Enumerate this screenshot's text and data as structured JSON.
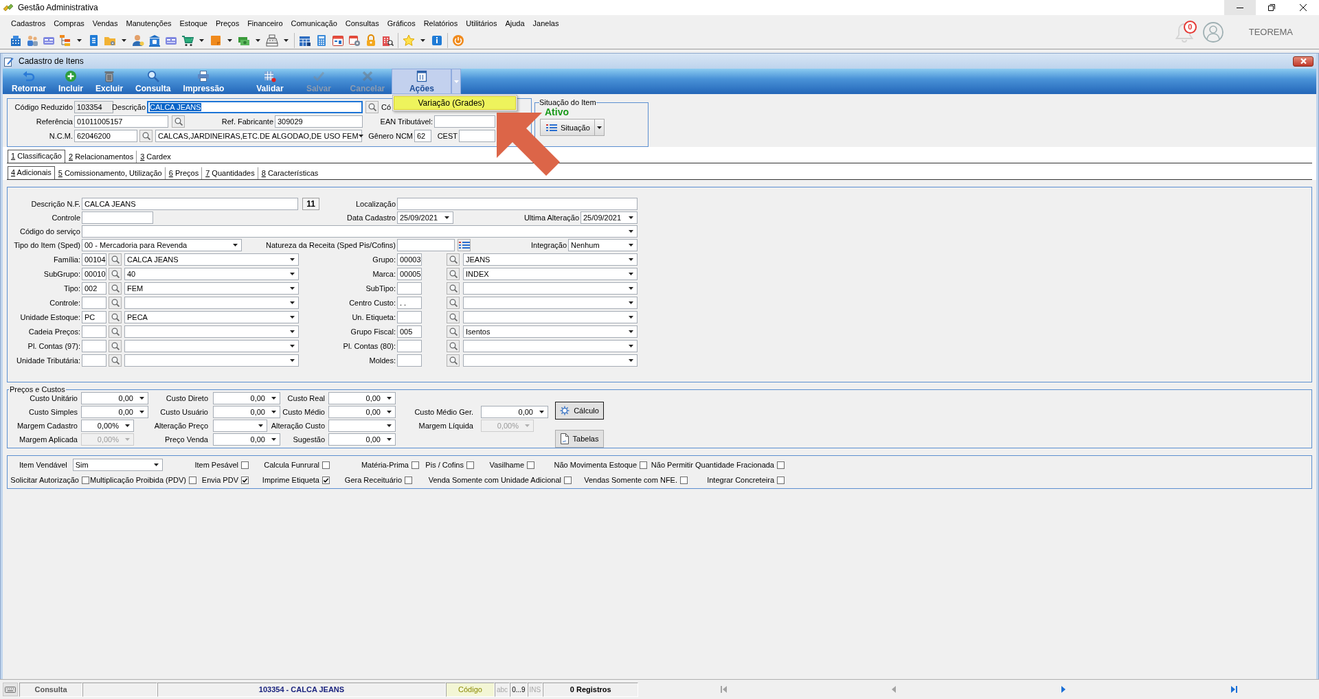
{
  "window": {
    "title": "Gestão Administrativa",
    "controls": [
      {
        "hover": true
      },
      {
        "hover": false
      },
      {
        "hover": false
      }
    ]
  },
  "menu": [
    "Cadastros",
    "Compras",
    "Vendas",
    "Manutenções",
    "Estoque",
    "Preços",
    "Financeiro",
    "Comunicação",
    "Consultas",
    "Gráficos",
    "Relatórios",
    "Utilitários",
    "Ajuda",
    "Janelas"
  ],
  "notifications": {
    "count": "0"
  },
  "user": {
    "name": "TEOREMA"
  },
  "form_window": {
    "title": "Cadastro de Itens"
  },
  "actions": [
    [
      {
        "label": "Retornar",
        "kind": "button",
        "disabled": false,
        "pressed": false
      },
      {
        "label": "Incluir",
        "kind": "button",
        "disabled": false,
        "pressed": false
      },
      {
        "label": "Excluir",
        "kind": "button",
        "disabled": false,
        "pressed": false
      },
      {
        "label": "Consulta",
        "kind": "button",
        "disabled": false,
        "pressed": false
      },
      {
        "label": "Impressão",
        "kind": "button",
        "disabled": false,
        "pressed": false
      }
    ],
    [
      {
        "label": "Validar",
        "kind": "button",
        "disabled": false,
        "pressed": false
      },
      {
        "label": "Salvar",
        "kind": "button",
        "disabled": true,
        "pressed": false
      },
      {
        "label": "Cancelar",
        "kind": "button",
        "disabled": true,
        "pressed": false
      }
    ],
    [
      {
        "label": "Ações",
        "kind": "split",
        "disabled": false,
        "pressed": true
      }
    ]
  ],
  "actions_menu": {
    "items": [
      {
        "label": "Variação (Grades)",
        "highlighted": true
      }
    ]
  },
  "header": {
    "code": {
      "label": "Código Reduzido",
      "value": "103354",
      "readonly": true
    },
    "description": {
      "label": "Descrição",
      "value": "CALCA JEANS",
      "focused": true,
      "text_selected": true
    },
    "covered_label": "Có",
    "reference": {
      "label": "Referência",
      "value": "01011005157"
    },
    "manufacturer_ref": {
      "label": "Ref. Fabricante",
      "value": "309029"
    },
    "ean": {
      "label": "EAN Tributável:"
    },
    "ncm": {
      "label": "N.C.M.",
      "value": "62046200",
      "description": "CALCAS,JARDINEIRAS,ETC.DE ALGODAO,DE USO FEM"
    },
    "ncm_genre": {
      "label": "Gênero NCM",
      "value": "62"
    },
    "cest": {
      "label": "CEST"
    }
  },
  "item_status": {
    "title": "Situação do Item",
    "status": "Ativo",
    "button": "Situação"
  },
  "tabs": [
    {
      "label": "1 Classificação",
      "selected": true
    },
    {
      "label": "2 Relacionamentos",
      "selected": false
    },
    {
      "label": "3 Cardex",
      "selected": false
    }
  ],
  "subtabs": [
    {
      "label": "4 Adicionais",
      "selected": true
    },
    {
      "label": "5 Comissionamento, Utilização",
      "selected": false
    },
    {
      "label": "6 Preços",
      "selected": false
    },
    {
      "label": "7 Quantidades",
      "selected": false
    },
    {
      "label": "8 Características",
      "selected": false
    }
  ],
  "details": {
    "description_nf": {
      "label": "Descrição N.F.",
      "value": "CALCA JEANS",
      "length": "11"
    },
    "location": {
      "label": "Localização"
    },
    "control": {
      "label": "Controle"
    },
    "created": {
      "label": "Data Cadastro",
      "value": "25/09/2021"
    },
    "modified": {
      "label": "Ultima Alteração",
      "value": "25/09/2021"
    },
    "service_code": {
      "label": "Código do serviço"
    },
    "item_type": {
      "label": "Tipo do Item (Sped)",
      "value": "00 - Mercadoria para Revenda"
    },
    "revenue_nature": {
      "label": "Natureza da Receita (Sped Pis/Cofins)"
    },
    "integration": {
      "label": "Integração",
      "value": "Nenhum"
    },
    "lookups": [
      [
        {
          "label": "Família:",
          "code": "00104",
          "name": "CALCA JEANS"
        },
        {
          "label": "Grupo:",
          "code": "00003",
          "name": "JEANS"
        }
      ],
      [
        {
          "label": "SubGrupo:",
          "code": "00010",
          "name": "40"
        },
        {
          "label": "Marca:",
          "code": "00005",
          "name": "INDEX"
        }
      ],
      [
        {
          "label": "Tipo:",
          "code": "002",
          "name": "FEM"
        },
        {
          "label": "SubTipo:"
        }
      ],
      [
        {
          "label": "Controle:"
        },
        {
          "label": "Centro Custo:",
          "code": ". ."
        }
      ],
      [
        {
          "label": "Unidade Estoque:",
          "code": "PC",
          "name": "PECA"
        },
        {
          "label": "Un. Etiqueta:"
        }
      ],
      [
        {
          "label": "Cadeia Preços:"
        },
        {
          "label": "Grupo Fiscal:",
          "code": "005",
          "name": "Isentos"
        }
      ],
      [
        {
          "label": "Pl. Contas (97):"
        },
        {
          "label": "Pl. Contas (80):"
        }
      ],
      [
        {
          "label": "Unidade Tributária:"
        },
        {
          "label": "Moldes:"
        }
      ]
    ]
  },
  "prices": {
    "title": "Preços e Custos",
    "columns": [
      [
        {
          "label": "Custo Unitário",
          "value": "0,00",
          "kind": "amount",
          "disabled": false
        },
        {
          "label": "Custo Simples",
          "value": "0,00",
          "kind": "amount",
          "disabled": false
        },
        {
          "label": "Margem Cadastro",
          "value": "0,00%",
          "kind": "percent",
          "disabled": false
        },
        {
          "label": "Margem Aplicada",
          "value": "0,00%",
          "kind": "percent",
          "disabled": true
        }
      ],
      [
        {
          "label": "Custo Direto",
          "value": "0,00",
          "kind": "amount",
          "disabled": false
        },
        {
          "label": "Custo Usuário",
          "value": "0,00",
          "kind": "amount",
          "disabled": false
        },
        {
          "label": "Alteração Preço",
          "kind": "select",
          "disabled": false
        },
        {
          "label": "Preço Venda",
          "value": "0,00",
          "kind": "amount",
          "disabled": false
        }
      ],
      [
        {
          "label": "Custo Real",
          "value": "0,00",
          "kind": "amount",
          "disabled": false
        },
        {
          "label": "Custo Médio",
          "value": "0,00",
          "kind": "amount",
          "disabled": false
        },
        {
          "label": "Alteração Custo",
          "kind": "amount",
          "disabled": false
        },
        {
          "label": "Sugestão",
          "value": "0,00",
          "kind": "amount",
          "disabled": false
        }
      ],
      [
        {
          "label": "Custo Médio Ger.",
          "value": "0,00",
          "kind": "amount",
          "disabled": false
        },
        {
          "label": "Margem Líquida",
          "value": "0,00%",
          "kind": "percent",
          "disabled": true
        }
      ]
    ],
    "buttons": [
      "Cálculo",
      "Tabelas"
    ]
  },
  "flags": {
    "first_line": {
      "sellable": {
        "label": "Item Vendável",
        "value": "Sim"
      },
      "checkboxes": [
        {
          "label": "Item Pesável",
          "checked": false
        },
        {
          "label": "Calcula Funrural",
          "checked": false
        },
        {
          "label": "Matéria-Prima",
          "checked": false
        },
        {
          "label": "Pis / Cofins",
          "checked": false
        },
        {
          "label": "Vasilhame",
          "checked": false
        },
        {
          "label": "Não Movimenta Estoque",
          "checked": false
        },
        {
          "label": "Não Permitir Quantidade Fracionada",
          "checked": false
        }
      ]
    },
    "second_line": {
      "checkboxes": [
        {
          "label": "Solicitar Autorização",
          "checked": false
        },
        {
          "label": "Multiplicação Proibida (PDV)",
          "checked": false
        },
        {
          "label": "Envia PDV",
          "checked": true
        },
        {
          "label": "Imprime Etiqueta",
          "checked": true
        },
        {
          "label": "Gera Receituário",
          "checked": false
        },
        {
          "label": "Venda Somente com Unidade Adicional",
          "checked": false
        },
        {
          "label": "Vendas Somente com NFE.",
          "checked": false
        },
        {
          "label": "Integrar Concreteira",
          "checked": false
        }
      ]
    }
  },
  "status_bar": {
    "mode": "Consulta",
    "record": "103354 - CALCA JEANS",
    "search_field": "Código",
    "indicators": [
      {
        "label": "abc",
        "on": false
      },
      {
        "label": "0...9",
        "on": true
      },
      {
        "label": "INS",
        "on": false
      }
    ],
    "count": "0 Registros",
    "navigation": [
      {
        "disabled": true
      },
      {
        "disabled": true
      },
      {
        "disabled": false
      },
      {
        "disabled": false
      }
    ]
  }
}
